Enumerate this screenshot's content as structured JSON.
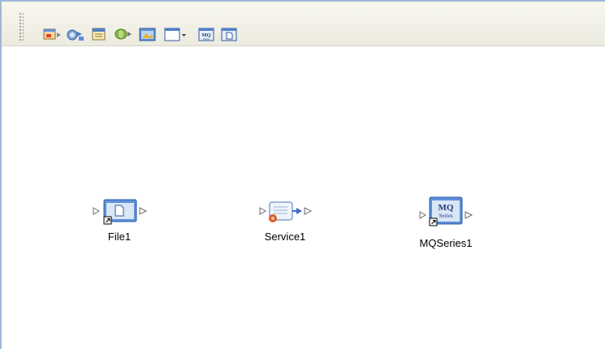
{
  "toolbar": {
    "buttons": [
      {
        "name": "file-tool-icon"
      },
      {
        "name": "service-tool-icon"
      },
      {
        "name": "calendar-tool-icon"
      },
      {
        "name": "database-tool-icon"
      },
      {
        "name": "image-tool-icon"
      },
      {
        "name": "window-dropdown-icon"
      },
      {
        "name": "mqseries-tool-icon"
      },
      {
        "name": "file-window-tool-icon"
      }
    ]
  },
  "canvas": {
    "nodes": [
      {
        "id": "file1",
        "label": "File1",
        "icon": "file-external-icon"
      },
      {
        "id": "service1",
        "label": "Service1",
        "icon": "service-icon"
      },
      {
        "id": "mqseries1",
        "label": "MQSeries1",
        "icon": "mqseries-external-icon"
      }
    ]
  },
  "colors": {
    "frame_border": "#9fb7d6",
    "toolbar_bg": "#ecebe0",
    "port": "#6a6a6a",
    "window_blue": "#3a6bc4"
  }
}
